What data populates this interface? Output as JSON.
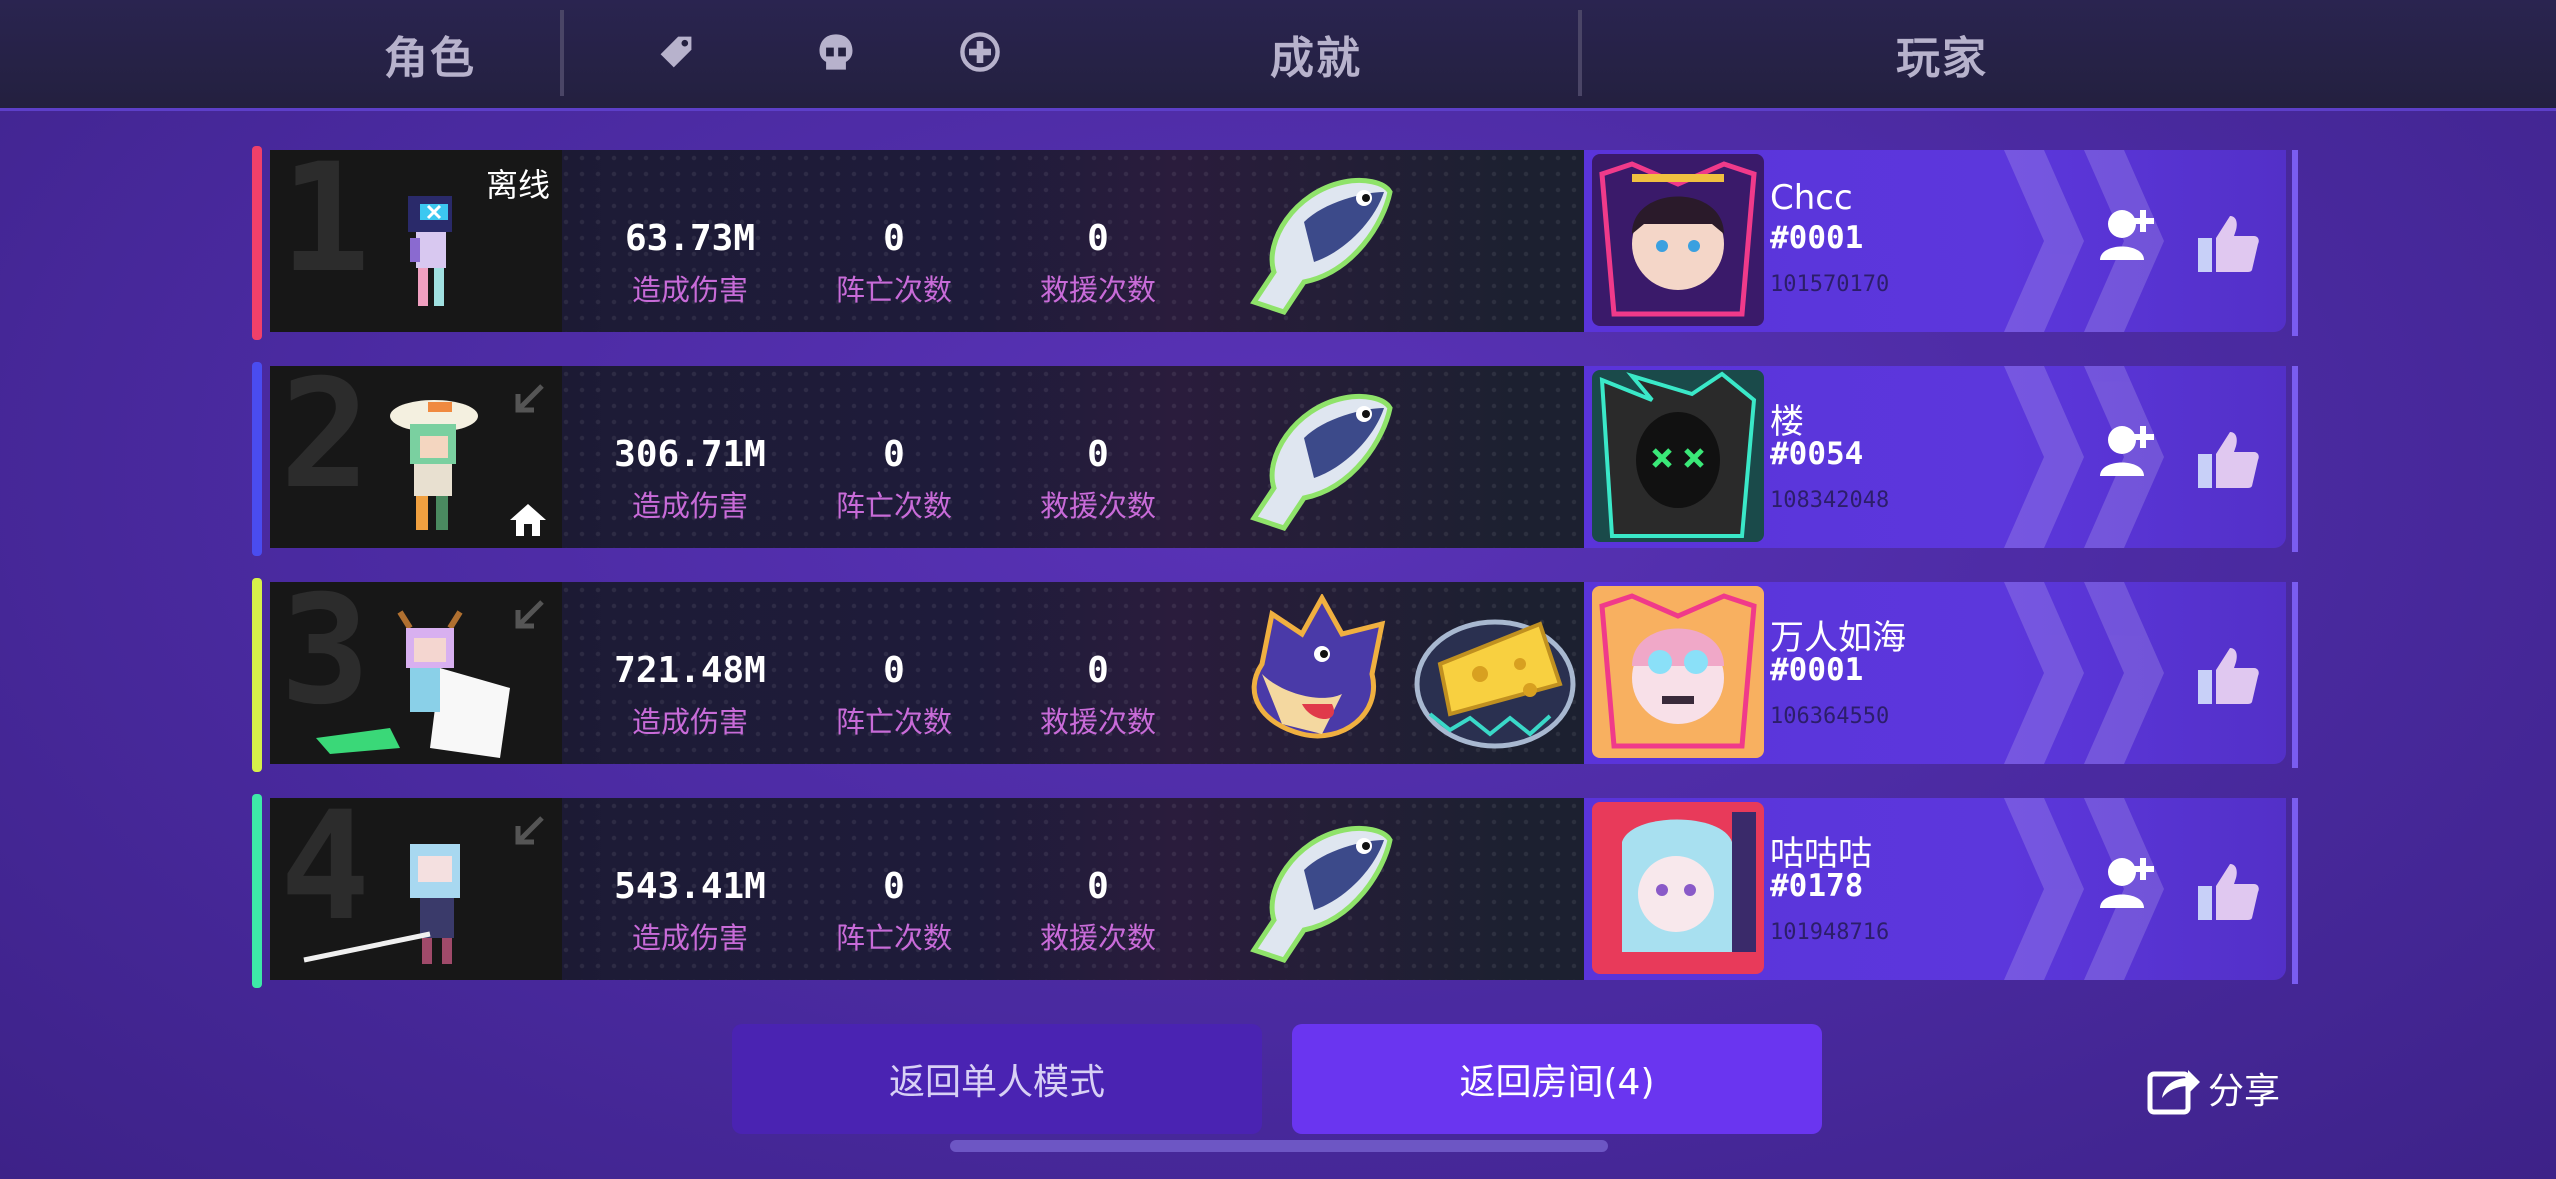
{
  "header": {
    "col_character": "角色",
    "col_achievement": "成就",
    "col_player": "玩家",
    "icons": [
      "tag-icon",
      "skull-icon",
      "heal-plus-icon"
    ]
  },
  "rows": [
    {
      "rank": "1",
      "accent": "#f0406a",
      "offline": "离线",
      "damage": "63.73M",
      "damage_label": "造成伤害",
      "deaths": "0",
      "deaths_label": "阵亡次数",
      "rescues": "0",
      "rescues_label": "救援次数",
      "achievements": [
        "fish-badge-icon"
      ],
      "player": {
        "name": "Chcc",
        "tag": "#0001",
        "id": "101570170"
      }
    },
    {
      "rank": "2",
      "accent": "#4a4cf0",
      "damage": "306.71M",
      "damage_label": "造成伤害",
      "deaths": "0",
      "deaths_label": "阵亡次数",
      "rescues": "0",
      "rescues_label": "救援次数",
      "achievements": [
        "fish-badge-icon"
      ],
      "player": {
        "name": "楼",
        "tag": "#0054",
        "id": "108342048"
      }
    },
    {
      "rank": "3",
      "accent": "#d6f04a",
      "damage": "721.48M",
      "damage_label": "造成伤害",
      "deaths": "0",
      "deaths_label": "阵亡次数",
      "rescues": "0",
      "rescues_label": "救援次数",
      "achievements": [
        "wolf-badge-icon",
        "cheese-badge-icon"
      ],
      "player": {
        "name": "万人如海",
        "tag": "#0001",
        "id": "106364550"
      }
    },
    {
      "rank": "4",
      "accent": "#3ee8a8",
      "damage": "543.41M",
      "damage_label": "造成伤害",
      "deaths": "0",
      "deaths_label": "阵亡次数",
      "rescues": "0",
      "rescues_label": "救援次数",
      "achievements": [
        "fish-badge-icon"
      ],
      "player": {
        "name": "咕咕咕",
        "tag": "#0178",
        "id": "101948716"
      }
    }
  ],
  "footer": {
    "back_solo": "返回单人模式",
    "back_room": "返回房间(4)",
    "share": "分享"
  }
}
